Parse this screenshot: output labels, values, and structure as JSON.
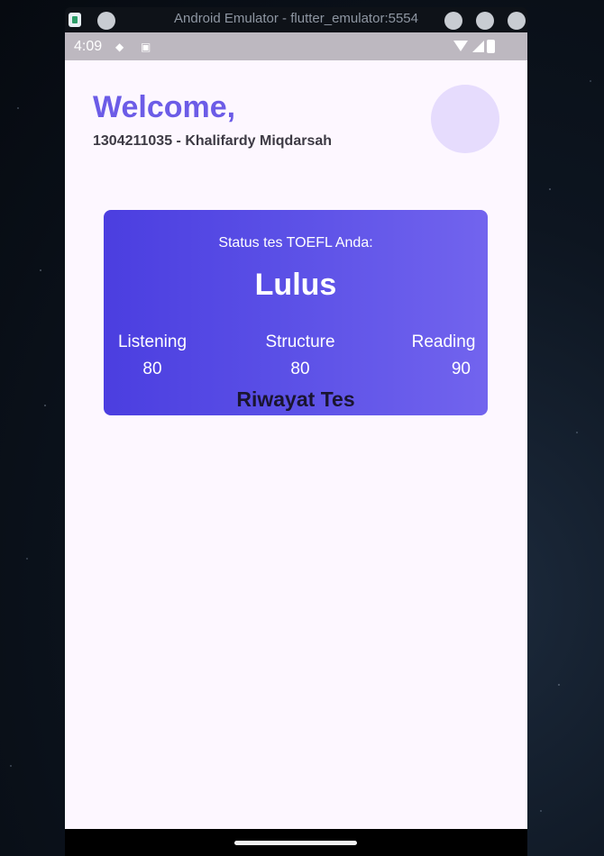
{
  "emulator": {
    "title": "Android Emulator - flutter_emulator:5554"
  },
  "status_bar": {
    "time": "4:09"
  },
  "header": {
    "welcome": "Welcome,",
    "user": "1304211035 - Khalifardy Miqdarsah"
  },
  "card": {
    "status_label": "Status tes TOEFL Anda:",
    "result": "Lulus",
    "scores": [
      {
        "label": "Listening",
        "value": "80"
      },
      {
        "label": "Structure",
        "value": "80"
      },
      {
        "label": "Reading",
        "value": "90"
      }
    ],
    "history_label": "Riwayat Tes"
  },
  "colors": {
    "accent": "#6c5ce7",
    "card_gradient_start": "#4b3ee0",
    "card_gradient_end": "#7264ee",
    "avatar": "#e6dcfd",
    "background": "#fdf7ff"
  }
}
